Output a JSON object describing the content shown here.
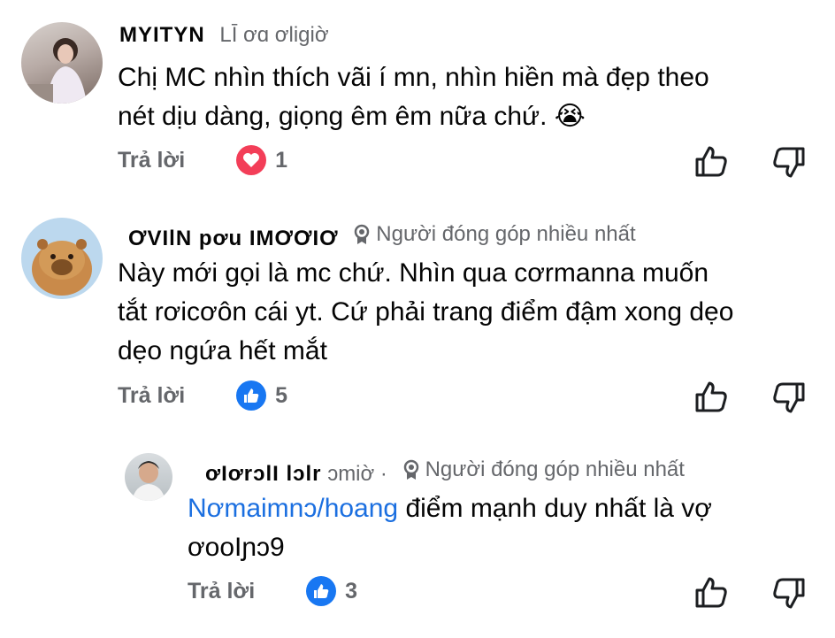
{
  "comments": [
    {
      "author": "MYITYN",
      "time": "LĪ ơɑ ơliɡiờ",
      "badge": "",
      "lines": [
        "Chị MC nhìn thích vãi í mn, nhìn hiền mà đẹp theo",
        "nét dịu dàng, giọng êm êm nữa chứ. 😭"
      ],
      "reply_label": "Trả lời",
      "reaction": "heart",
      "reaction_count": "1"
    },
    {
      "author": "ƠVIlN pơu IMƠƠIƠ",
      "time": "",
      "badge": "Người đóng góp nhiều nhất",
      "lines": [
        "Này mới gọi là mc chứ. Nhìn qua cơrmanna muốn",
        "tắt rơicơôn cái yt. Cứ phải trang điểm đậm xong dẹo",
        "dẹo ngứa hết mắt"
      ],
      "reply_label": "Trả lời",
      "reaction": "like",
      "reaction_count": "5"
    },
    {
      "author": "ơIơrɔlI lɔlr",
      "time": "ɔmiờ ·",
      "badge": "Người đóng góp nhiều nhất",
      "mention": "Nơmaimnɔ/hoang",
      "line1_rest": " điểm mạnh duy nhất là vợ",
      "line2": "ơooIɲɔ9",
      "reply_label": "Trả lời",
      "reaction": "like",
      "reaction_count": "3"
    }
  ],
  "icons": {
    "like_color": "#1877f2",
    "heart_color": "#f33e58",
    "badge_icon": "top-contributor-badge-icon",
    "upvote_icon": "thumbs-up-outline-icon",
    "downvote_icon": "thumbs-down-outline-icon"
  }
}
